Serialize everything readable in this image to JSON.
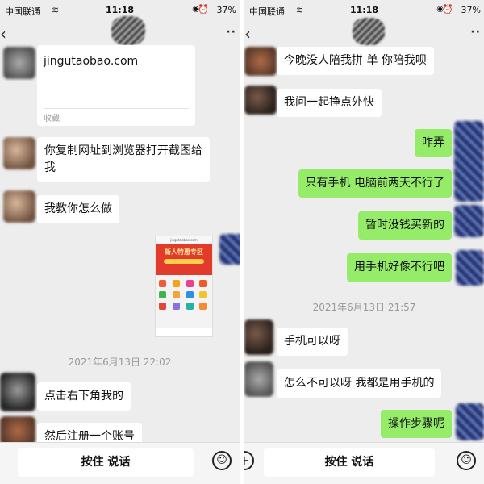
{
  "status_bar": {
    "carrier": "中国联通",
    "time": "11:18",
    "battery": "37%"
  },
  "left_panel": {
    "link_card": {
      "url": "jingutaobao.com",
      "source_label": "收藏"
    },
    "messages": [
      {
        "text": "你复制网址到浏览器打开截图给我"
      },
      {
        "text": "我教你怎么做"
      }
    ],
    "mini_screenshot": {
      "address": "jingutaobao.com",
      "banner": "新人特惠专区"
    },
    "timestamp": "2021年6月13日 22:02",
    "messages_after": [
      {
        "text": "点击右下角我的"
      },
      {
        "text": "然后注册一个账号"
      }
    ],
    "input": {
      "voice_label": "按住 说话"
    }
  },
  "right_panel": {
    "messages_before": [
      {
        "text": "今晚没人陪我拼  单  你陪我呗",
        "side": "left"
      },
      {
        "text": "我问一起挣点外快",
        "side": "left"
      },
      {
        "text": "咋弄",
        "side": "right"
      },
      {
        "text": "只有手机  电脑前两天不行了",
        "side": "right"
      },
      {
        "text": "暂时没钱买新的",
        "side": "right"
      },
      {
        "text": "用手机好像不行吧",
        "side": "right"
      }
    ],
    "timestamp": "2021年6月13日 21:57",
    "messages_after": [
      {
        "text": "手机可以呀",
        "side": "left"
      },
      {
        "text": "怎么不可以呀 我都是用手机的",
        "side": "left"
      },
      {
        "text": "操作步骤呢",
        "side": "right"
      }
    ],
    "input": {
      "voice_label": "按住 说话"
    }
  },
  "colors": {
    "chat_background": "#ededed",
    "sent_bubble": "#95ec69",
    "received_bubble": "#ffffff",
    "timestamp": "#999999"
  }
}
